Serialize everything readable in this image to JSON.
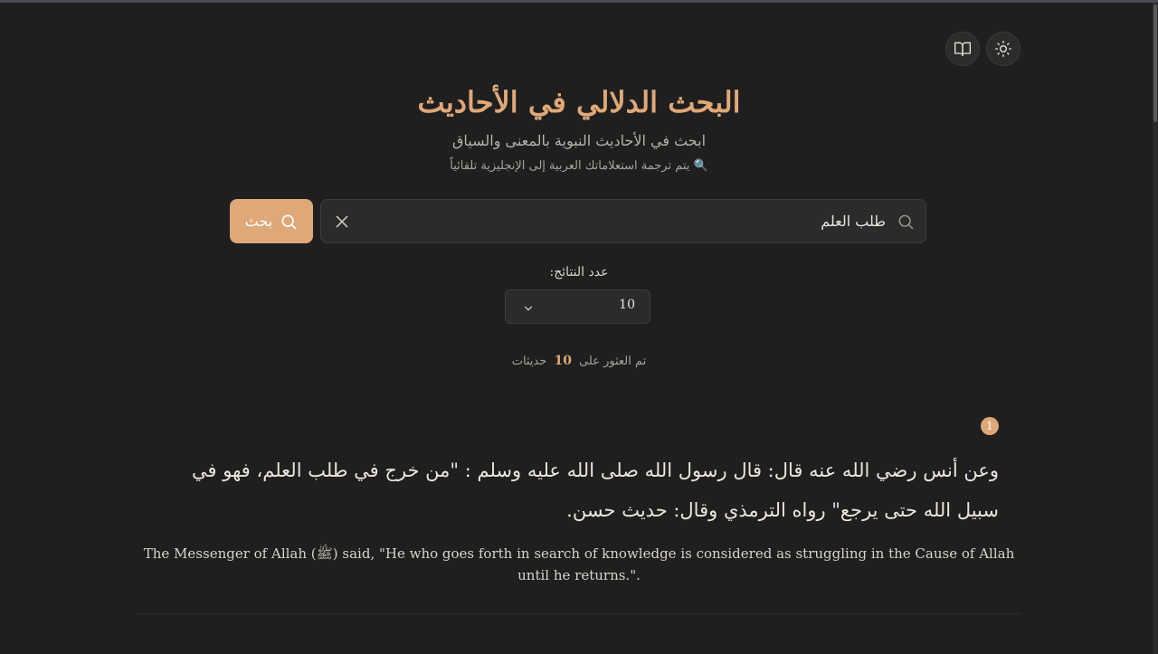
{
  "header": {
    "title": "البحث الدلالي في الأحاديث",
    "subtitle": "ابحث في الأحاديث النبوية بالمعنى والسياق",
    "note": "🔍 يتم ترجمة استعلاماتك العربية إلى الإنجليزية تلقائياً"
  },
  "toolbar": {
    "theme_icon": "sun-icon",
    "book_icon": "book-icon"
  },
  "search": {
    "value": "طلب العلم",
    "placeholder": "",
    "button_label": "بحث"
  },
  "results_count": {
    "label": "عدد النتائج:",
    "selected": "10"
  },
  "summary": {
    "prefix": "تم العثور على",
    "count": "10",
    "suffix": "حديثات"
  },
  "results": [
    {
      "number": "1",
      "arabic": "وعن أنس رضي الله عنه قال: قال رسول الله صلى الله عليه وسلم : \"من خرج في طلب العلم، فهو في سبيل الله حتى يرجع\" رواه الترمذي وقال: حديث حسن.",
      "english": "The Messenger of Allah (ﷺ) said, \"He who goes forth in search of knowledge is considered as struggling in the Cause of Allah until he returns.\"."
    }
  ],
  "colors": {
    "background": "#1f1f1f",
    "accent": "#dfa878",
    "surface": "#2b2b2b"
  }
}
